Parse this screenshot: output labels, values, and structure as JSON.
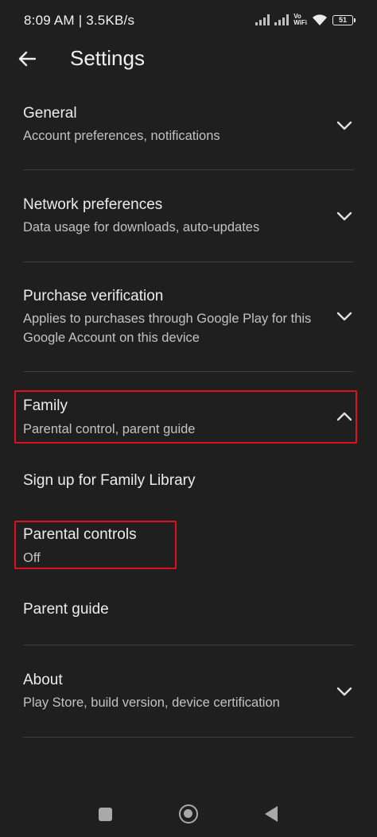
{
  "status_bar": {
    "time": "8:09 AM | 3.5KB/s",
    "volte_top": "Vo",
    "volte_bottom": "WiFi",
    "battery": "51"
  },
  "header": {
    "title": "Settings"
  },
  "settings": {
    "general": {
      "title": "General",
      "subtitle": "Account preferences, notifications"
    },
    "network": {
      "title": "Network preferences",
      "subtitle": "Data usage for downloads, auto-updates"
    },
    "purchase": {
      "title": "Purchase verification",
      "subtitle_line1": "Applies to purchases through Google Play for this",
      "subtitle_line2": "Google Account on this device"
    },
    "family": {
      "title": "Family",
      "subtitle": "Parental control, parent guide",
      "expanded": true,
      "children": {
        "family_library": "Sign up for Family Library",
        "parental_controls_title": "Parental controls",
        "parental_controls_value": "Off",
        "parent_guide": "Parent guide"
      }
    },
    "about": {
      "title": "About",
      "subtitle": "Play Store, build version, device certification"
    }
  },
  "colors": {
    "background": "#1f1f1f",
    "highlight": "#e0111e"
  }
}
